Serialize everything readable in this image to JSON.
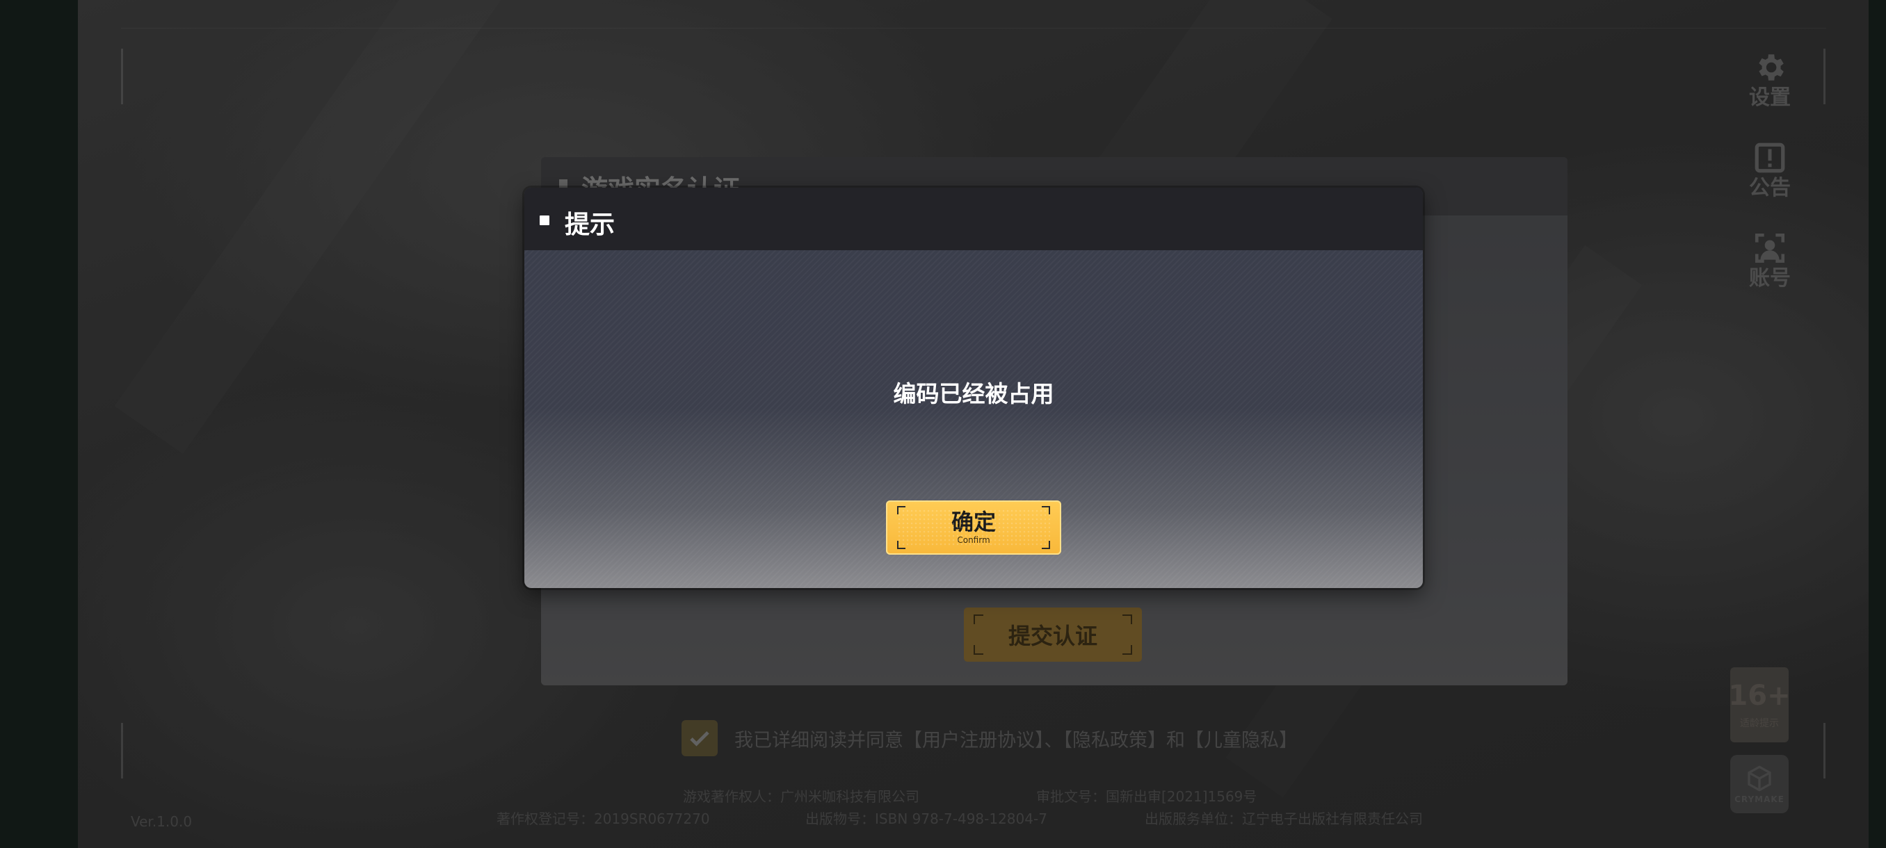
{
  "side_menu": {
    "settings_label": "设置",
    "notice_label": "公告",
    "account_label": "账号"
  },
  "age_badge": {
    "age": "16+",
    "tip": "适龄提示"
  },
  "brand": {
    "name": "CRYMAKE"
  },
  "version": "Ver.1.0.0",
  "background_panel": {
    "title": "游戏实名认证",
    "submit_label": "提交认证"
  },
  "agreement": {
    "text": "我已详细阅读并同意【用户注册协议】、【隐私政策】和【儿童隐私】"
  },
  "footer": {
    "operator": "游戏著作权人：广州米咖科技有限公司",
    "approval": "审批文号：国新出审[2021]1569号",
    "registration": "著作权登记号：2019SR0677270",
    "isbn": "出版物号：ISBN 978-7-498-12804-7",
    "publisher": "出版服务单位：辽宁电子出版社有限责任公司"
  },
  "dialog": {
    "title": "提示",
    "message": "编码已经被占用",
    "confirm_label": "确定",
    "confirm_sub": "Confirm"
  },
  "colors": {
    "accent": "#f8b83a",
    "dialog_header": "#232328",
    "dialog_body": "#3a3d4b"
  }
}
